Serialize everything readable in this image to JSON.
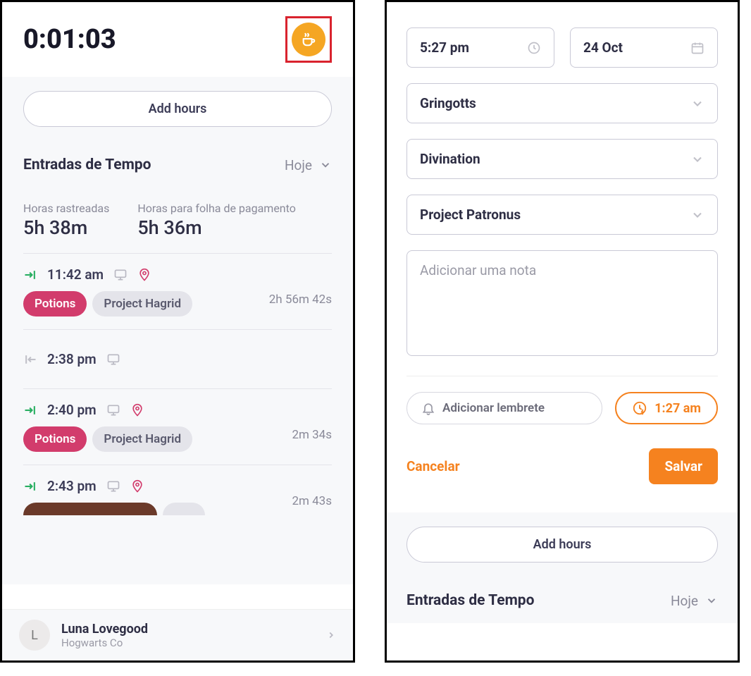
{
  "left": {
    "timer": "0:01:03",
    "add_hours": "Add hours",
    "entries_title": "Entradas de Tempo",
    "today_label": "Hoje",
    "summary": {
      "tracked_label": "Horas rastreadas",
      "tracked_value": "5h 38m",
      "payroll_label": "Horas para folha de pagamento",
      "payroll_value": "5h 36m"
    },
    "entries": [
      {
        "dir": "in",
        "time": "11:42 am",
        "duration": "2h 56m 42s",
        "tag1": "Potions",
        "tag2": "Project Hagrid"
      },
      {
        "dir": "out",
        "time": "2:38 pm",
        "duration": ""
      },
      {
        "dir": "in",
        "time": "2:40 pm",
        "duration": "2m 34s",
        "tag1": "Potions",
        "tag2": "Project Hagrid"
      },
      {
        "dir": "in",
        "time": "2:43 pm",
        "duration": "2m 43s"
      }
    ],
    "user": {
      "initial": "L",
      "name": "Luna Lovegood",
      "org": "Hogwarts Co"
    }
  },
  "right": {
    "time_value": "5:27 pm",
    "date_value": "24 Oct",
    "select_company": "Gringotts",
    "select_dept": "Divination",
    "select_project": "Project Patronus",
    "notes_placeholder": "Adicionar uma nota",
    "reminder_label": "Adicionar lembrete",
    "clockout_time": "1:27 am",
    "cancel": "Cancelar",
    "save": "Salvar",
    "add_hours": "Add hours",
    "entries_title": "Entradas de Tempo",
    "today_label": "Hoje"
  }
}
